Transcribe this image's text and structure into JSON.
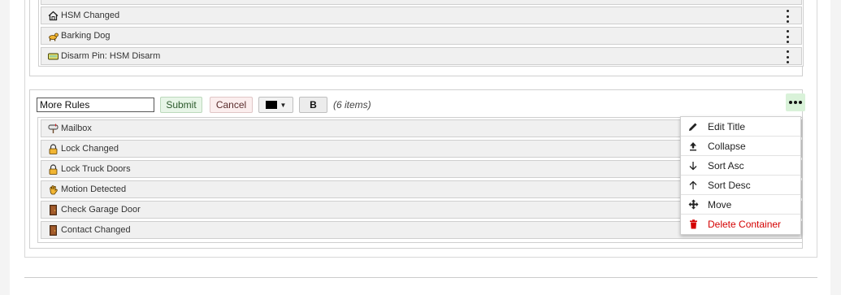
{
  "top_list": {
    "rows": [
      {
        "label": "HSM Changed",
        "icon": "house-icon"
      },
      {
        "label": "Barking Dog",
        "icon": "dog-icon"
      },
      {
        "label": "Disarm Pin: HSM Disarm",
        "icon": "keypad-icon"
      }
    ]
  },
  "container": {
    "title_value": "More Rules",
    "submit_label": "Submit",
    "cancel_label": "Cancel",
    "bold_label": "B",
    "items_count": "(6 items)",
    "color_value": "#000000",
    "rows": [
      {
        "label": "Mailbox",
        "icon": "mailbox-icon"
      },
      {
        "label": "Lock Changed",
        "icon": "lock-icon"
      },
      {
        "label": "Lock Truck Doors",
        "icon": "lock-icon"
      },
      {
        "label": "Motion Detected",
        "icon": "hand-wave-icon"
      },
      {
        "label": "Check Garage Door",
        "icon": "door-icon"
      },
      {
        "label": "Contact Changed",
        "icon": "door-icon"
      }
    ]
  },
  "menu": {
    "items": [
      {
        "label": "Edit Title",
        "icon": "pencil-icon"
      },
      {
        "label": "Collapse",
        "icon": "collapse-icon"
      },
      {
        "label": "Sort Asc",
        "icon": "arrow-down-icon"
      },
      {
        "label": "Sort Desc",
        "icon": "arrow-up-icon"
      },
      {
        "label": "Move",
        "icon": "move-icon"
      },
      {
        "label": "Delete Container",
        "icon": "trash-icon"
      }
    ],
    "danger_color": "#d40000"
  }
}
